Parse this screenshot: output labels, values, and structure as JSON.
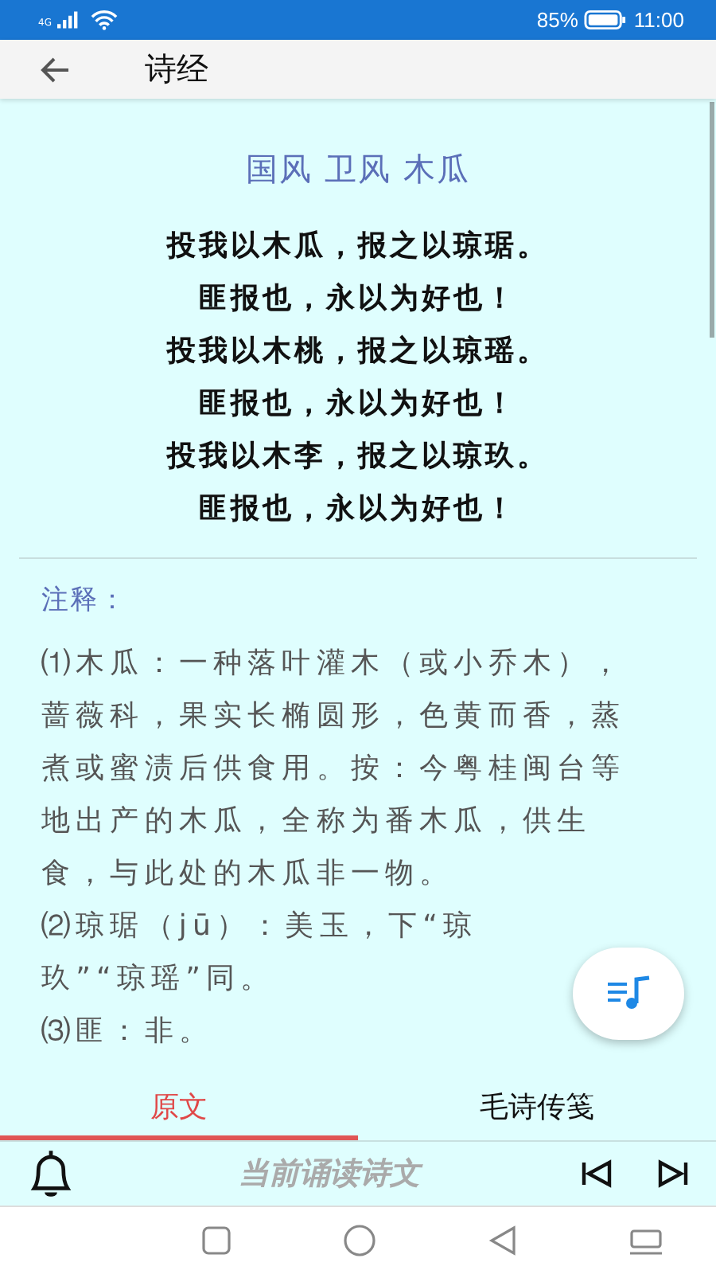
{
  "status_bar": {
    "network": "4G",
    "battery": "85%",
    "time": "11:00"
  },
  "app_bar": {
    "title": "诗经"
  },
  "poem": {
    "title": "国风 卫风 木瓜",
    "lines": [
      "投我以木瓜，报之以琼琚。",
      "匪报也，永以为好也！",
      "投我以木桃，报之以琼瑶。",
      "匪报也，永以为好也！",
      "投我以木李，报之以琼玖。",
      "匪报也，永以为好也！"
    ]
  },
  "notes": {
    "heading": "注释：",
    "items": [
      "⑴木瓜：一种落叶灌木（或小乔木），蔷薇科，果实长椭圆形，色黄而香，蒸煮或蜜渍后供食用。按：今粤桂闽台等地出产的木瓜，全称为番木瓜，供生食，与此处的木瓜非一物。",
      "⑵琼琚（jū）：美玉，下“琼玖”“琼瑶”同。",
      "⑶匪：非。"
    ]
  },
  "tabs": [
    {
      "label": "原文",
      "selected": true
    },
    {
      "label": "毛诗传笺",
      "selected": false
    }
  ],
  "player": {
    "now_reading": "当前诵读诗文"
  }
}
